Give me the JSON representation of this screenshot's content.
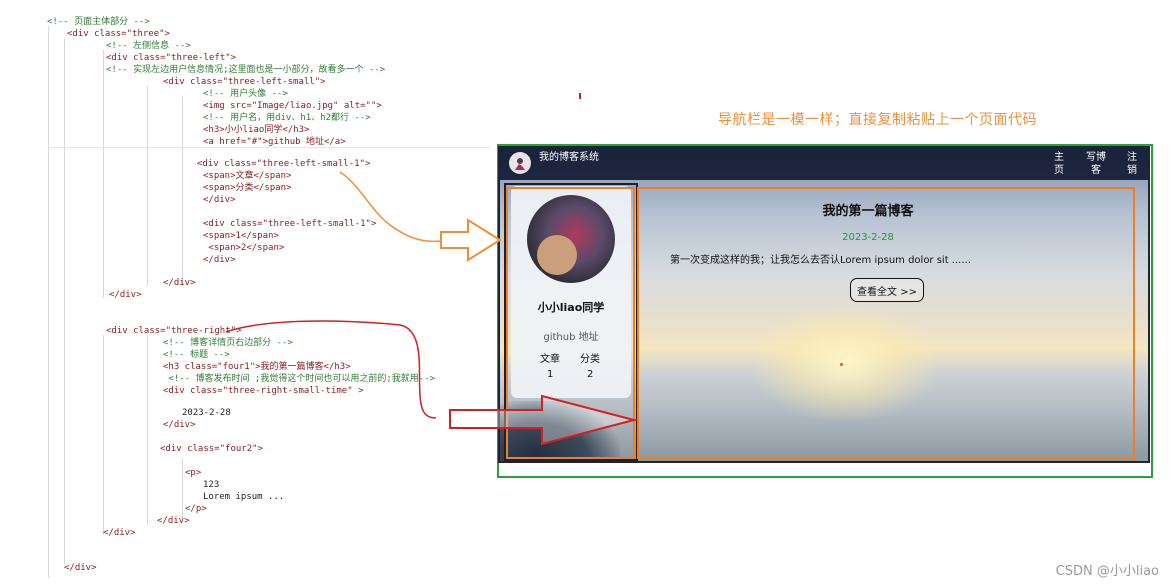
{
  "code_lines": [
    {
      "id": "c1",
      "text": "<!-- 页面主体部分 -->"
    },
    {
      "id": "c2",
      "text": "<div class=\"three\">"
    },
    {
      "id": "c3",
      "text": "<!-- 左侧信息 -->"
    },
    {
      "id": "c4",
      "text": "<div class=\"three-left\">"
    },
    {
      "id": "c5",
      "text": "<!-- 实现左边用户信息情况;这里面也是一小部分，故看多一个 -->"
    },
    {
      "id": "c6",
      "text": "<div class=\"three-left-small\">"
    },
    {
      "id": "c7",
      "text": "<!-- 用户头像 -->"
    },
    {
      "id": "c8",
      "text": "<img src=\"Image/liao.jpg\" alt=\"\">"
    },
    {
      "id": "c9",
      "text": "<!-- 用户名，用div、h1、h2都行 -->"
    },
    {
      "id": "c10",
      "text": "<h3>小小liao同学</h3>"
    },
    {
      "id": "c11",
      "text": "<a href=\"#\">github 地址</a>"
    },
    {
      "id": "c12",
      "text": "<div class=\"three-left-small-1\">"
    },
    {
      "id": "c13",
      "text": "<span>文章</span>"
    },
    {
      "id": "c14",
      "text": "<span>分类</span>"
    },
    {
      "id": "c15",
      "text": "</div>"
    },
    {
      "id": "c16",
      "text": "<div class=\"three-left-small-1\">"
    },
    {
      "id": "c17",
      "text": "<span>1</span>"
    },
    {
      "id": "c18",
      "text": " <span>2</span>"
    },
    {
      "id": "c19",
      "text": "</div>"
    },
    {
      "id": "c20",
      "text": "</div>"
    },
    {
      "id": "c21",
      "text": "</div>"
    },
    {
      "id": "c22",
      "text": "<div class=\"three-right\">"
    },
    {
      "id": "c23",
      "text": "<!-- 博客详情页右边部分 -->"
    },
    {
      "id": "c24",
      "text": "<!-- 标题 -->"
    },
    {
      "id": "c25",
      "text": "<h3 class=\"four1\">我的第一篇博客</h3>"
    },
    {
      "id": "c26",
      "text": " <!-- 博客发布时间 ;我觉得这个时间也可以用之前的;我就用-->"
    },
    {
      "id": "c27",
      "text": "<div class=\"three-right-small-time\" >"
    },
    {
      "id": "c28",
      "text": "2023-2-28"
    },
    {
      "id": "c29",
      "text": "</div>"
    },
    {
      "id": "c30",
      "text": "<div class=\"four2\">"
    },
    {
      "id": "c31",
      "text": "<p>"
    },
    {
      "id": "c32",
      "text": "123"
    },
    {
      "id": "c33",
      "text": "Lorem ipsum ..."
    },
    {
      "id": "c34",
      "text": "</p>"
    },
    {
      "id": "c35",
      "text": "</div>"
    },
    {
      "id": "c36",
      "text": "</div>"
    },
    {
      "id": "c37",
      "text": "</div>"
    }
  ],
  "annotation": "导航栏是一模一样；直接复制粘贴上一个页面代码",
  "watermark": "CSDN @小小liao",
  "preview": {
    "nav": {
      "title": "我的博客系统",
      "items": [
        "主页",
        "写博客",
        "注销"
      ]
    },
    "profile": {
      "username": "小小liao同学",
      "github_label": "github 地址",
      "stats_labels": [
        "文章",
        "分类"
      ],
      "stats_values": [
        "1",
        "2"
      ]
    },
    "blog": {
      "title": "我的第一篇博客",
      "date": "2023-2-28",
      "excerpt": "第一次变成这样的我；让我怎么去否认Lorem ipsum dolor sit ......",
      "read_more": "查看全文 >>"
    }
  },
  "colors": {
    "annotation": "#ef8f3a",
    "frame_green": "#22a43a",
    "frame_orange": "#ef7e29",
    "arrow_red": "#d81e1e",
    "date_green": "#1b9a3c"
  }
}
